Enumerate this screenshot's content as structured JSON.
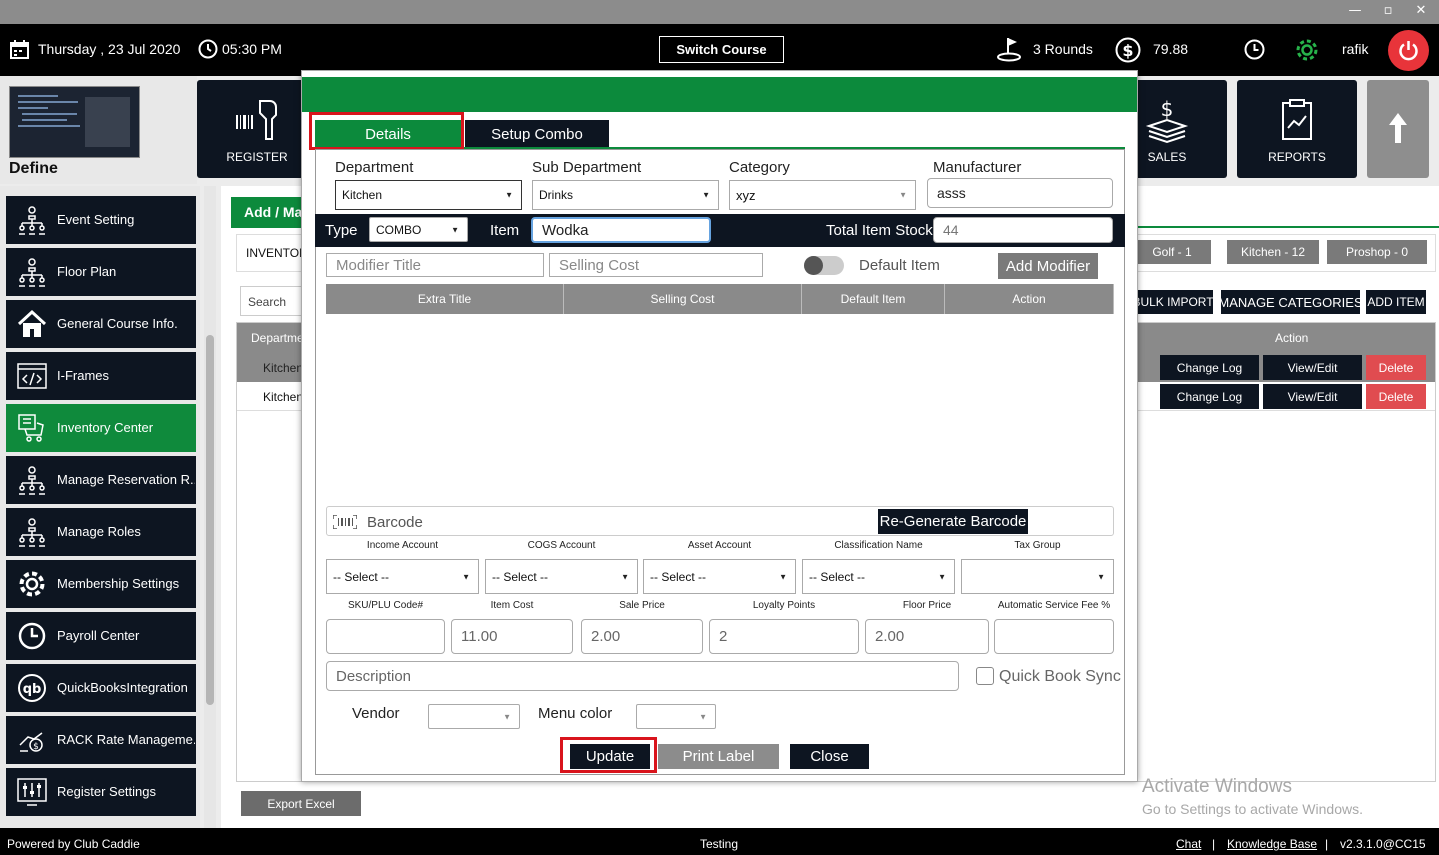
{
  "titlebar": {
    "minimize": "—",
    "restore": "▫",
    "close": "✕"
  },
  "topbar": {
    "date": "Thursday ,  23 Jul 2020",
    "time": "05:30 PM",
    "switch_course": "Switch Course",
    "rounds": "3 Rounds",
    "balance": "79.88",
    "user": "rafik"
  },
  "define": {
    "label": "Define"
  },
  "nav_tiles": [
    {
      "label": "REGISTER",
      "icon": "barcode-scanner-icon"
    },
    {
      "label": "SALES",
      "icon": "dollar-stack-icon"
    },
    {
      "label": "REPORTS",
      "icon": "report-chart-icon"
    },
    {
      "label": "",
      "icon": "up-arrow-icon"
    }
  ],
  "sidebar": {
    "items": [
      {
        "label": "Event Setting",
        "icon": "org-chart-icon"
      },
      {
        "label": "Floor Plan",
        "icon": "org-chart-icon"
      },
      {
        "label": "General Course Info.",
        "icon": "home-icon"
      },
      {
        "label": "I-Frames",
        "icon": "code-icon"
      },
      {
        "label": "Inventory Center",
        "icon": "inventory-icon",
        "active": true
      },
      {
        "label": "Manage Reservation R...",
        "icon": "org-chart-icon"
      },
      {
        "label": "Manage Roles",
        "icon": "org-chart-icon"
      },
      {
        "label": "Membership Settings",
        "icon": "gear-icon"
      },
      {
        "label": "Payroll Center",
        "icon": "clock-icon"
      },
      {
        "label": "QuickBooksIntegration",
        "icon": "quickbooks-icon"
      },
      {
        "label": "RACK Rate Manageme...",
        "icon": "rate-icon"
      },
      {
        "label": "Register Settings",
        "icon": "sliders-icon"
      }
    ]
  },
  "main": {
    "add_button": "Add / Ma",
    "inventory_label": "INVENTOR",
    "search_placeholder": "Search",
    "filters": [
      "Golf - 1",
      "Kitchen - 12",
      "Proshop - 0"
    ],
    "bulk_import": "BULK IMPORT",
    "manage_categories": "MANAGE CATEGORIES",
    "add_item": "ADD ITEM",
    "table_header_dept": "Departme",
    "table_header_action": "Action",
    "rows": [
      {
        "dept": "Kitchen"
      },
      {
        "dept": "Kitchen"
      }
    ],
    "change_log": "Change Log",
    "view_edit": "View/Edit",
    "delete": "Delete",
    "export_excel": "Export Excel"
  },
  "modal": {
    "tabs": {
      "details": "Details",
      "setup_combo": "Setup Combo"
    },
    "department_label": "Department",
    "department_value": "Kitchen",
    "subdept_label": "Sub Department",
    "subdept_value": "Drinks",
    "category_label": "Category",
    "category_value": "xyz",
    "manufacturer_label": "Manufacturer",
    "manufacturer_value": "asss",
    "type_label": "Type",
    "type_value": "COMBO",
    "item_label": "Item",
    "item_value": "Wodka",
    "total_stock_label": "Total Item Stock",
    "total_stock_value": "44",
    "modifier_title_placeholder": "Modifier Title",
    "selling_cost_placeholder": "Selling Cost",
    "default_item_label": "Default Item",
    "add_modifier": "Add Modifier",
    "grid_headers": [
      "Extra Title",
      "Selling Cost",
      "Default Item",
      "Action"
    ],
    "barcode_placeholder": "Barcode",
    "regen_barcode": "Re-Generate Barcode",
    "account_labels": [
      "Income Account",
      "COGS Account",
      "Asset Account",
      "Classification Name",
      "Tax Group"
    ],
    "account_values": [
      "-- Select --",
      "-- Select --",
      "-- Select --",
      "-- Select --",
      ""
    ],
    "price_labels": [
      "SKU/PLU Code#",
      "Item Cost",
      "Sale Price",
      "Loyalty Points",
      "Floor Price",
      "Automatic Service Fee %"
    ],
    "price_values": [
      "",
      "11.00",
      "2.00",
      "2",
      "2.00",
      ""
    ],
    "description_placeholder": "Description",
    "quick_book_sync": "Quick Book Sync",
    "vendor_label": "Vendor",
    "menu_color_label": "Menu color",
    "update": "Update",
    "print_label": "Print Label",
    "close": "Close"
  },
  "watermark": {
    "line1": "Activate Windows",
    "line2": "Go to Settings to activate Windows."
  },
  "statusbar": {
    "powered": "Powered by Club Caddie",
    "center": "Testing",
    "chat": "Chat",
    "sep": "|",
    "kb": "Knowledge Base",
    "version": "v2.3.1.0@CC15"
  },
  "colors": {
    "brand_green": "#0c8a3c",
    "dark_navy": "#0d1521",
    "danger": "#e04c50",
    "highlight_red": "#d9141c"
  }
}
